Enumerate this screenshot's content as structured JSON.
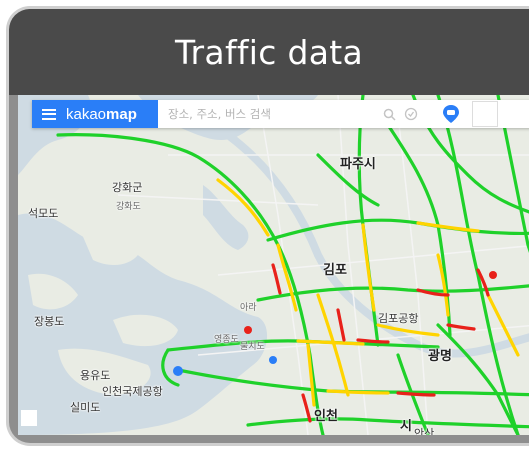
{
  "window": {
    "title": "Traffic data"
  },
  "searchbar": {
    "brand_prefix": "kakao",
    "brand_suffix": "map",
    "placeholder": "장소, 주소, 버스 검색"
  },
  "map_labels": {
    "paju": "파주시",
    "ganghwagun": "강화군",
    "ganghwado": "강화도",
    "seokmodo": "석모도",
    "gimpo": "김포",
    "jangbongdo": "장봉도",
    "yongyudo": "용유도",
    "incheon_airport": "인천국제공항",
    "silmido": "실미도",
    "incheon": "인천",
    "sihung": "시",
    "gwangmyeong": "광명",
    "gimpo_airport": "김포공항",
    "ara": "아라",
    "yeongjongdo": "영종도",
    "mulchido": "물치도",
    "ansan": "안산"
  },
  "colors": {
    "traffic_green": "#1fd12a",
    "traffic_yellow": "#ffd400",
    "traffic_red": "#e8211a",
    "brand_blue": "#2a7ef7",
    "title_bg": "#4a4a4a"
  }
}
